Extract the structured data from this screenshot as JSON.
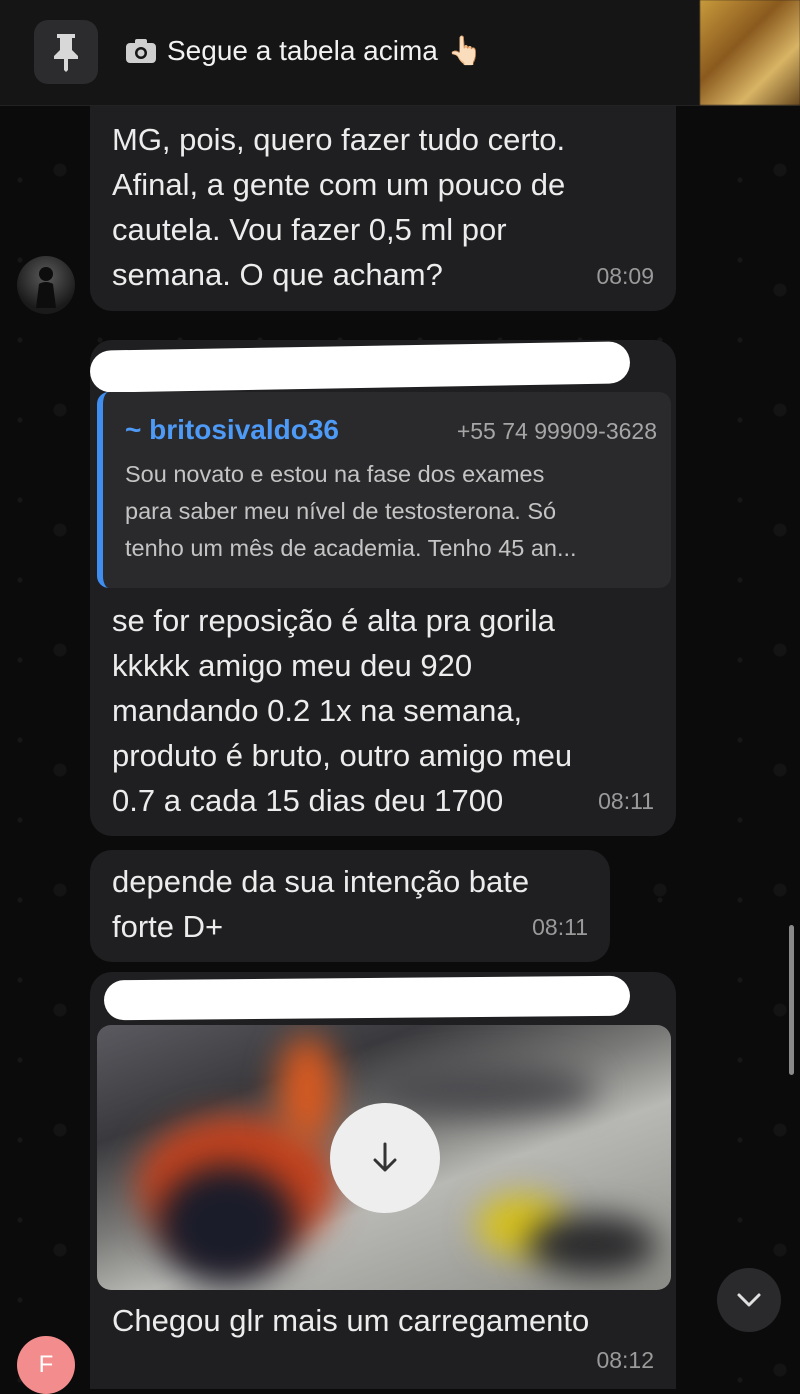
{
  "pinned": {
    "text": "Segue a tabela acima",
    "emoji": "👆🏻"
  },
  "messages": [
    {
      "lines": [
        "MG, pois, quero fazer tudo certo.",
        "Afinal, a gente com um pouco de",
        "cautela. Vou fazer 0,5 ml por",
        "semana. O que acham?"
      ],
      "time": "08:09"
    },
    {
      "quote": {
        "name": "~ britosivaldo36",
        "phone": "+55 74 99909-3628",
        "lines": [
          "Sou novato e estou na fase dos exames",
          "para saber meu nível de testosterona. Só",
          "tenho um mês de academia. Tenho 45 an..."
        ]
      },
      "lines": [
        "se for reposição é alta pra gorila",
        "kkkkk amigo meu deu 920",
        "mandando 0.2 1x na semana,",
        "produto é bruto, outro amigo meu",
        "0.7 a cada 15 dias deu 1700"
      ],
      "time": "08:11"
    },
    {
      "lines": [
        "depende da sua intenção bate",
        "forte D+"
      ],
      "time": "08:11"
    },
    {
      "caption": "Chegou glr mais um carregamento",
      "time": "08:12"
    }
  ],
  "avatar_letter": "F",
  "colors": {
    "bubble": "#1f1f21",
    "quote_accent": "#3f8ef0",
    "avatar_f": "#f38c8c"
  }
}
